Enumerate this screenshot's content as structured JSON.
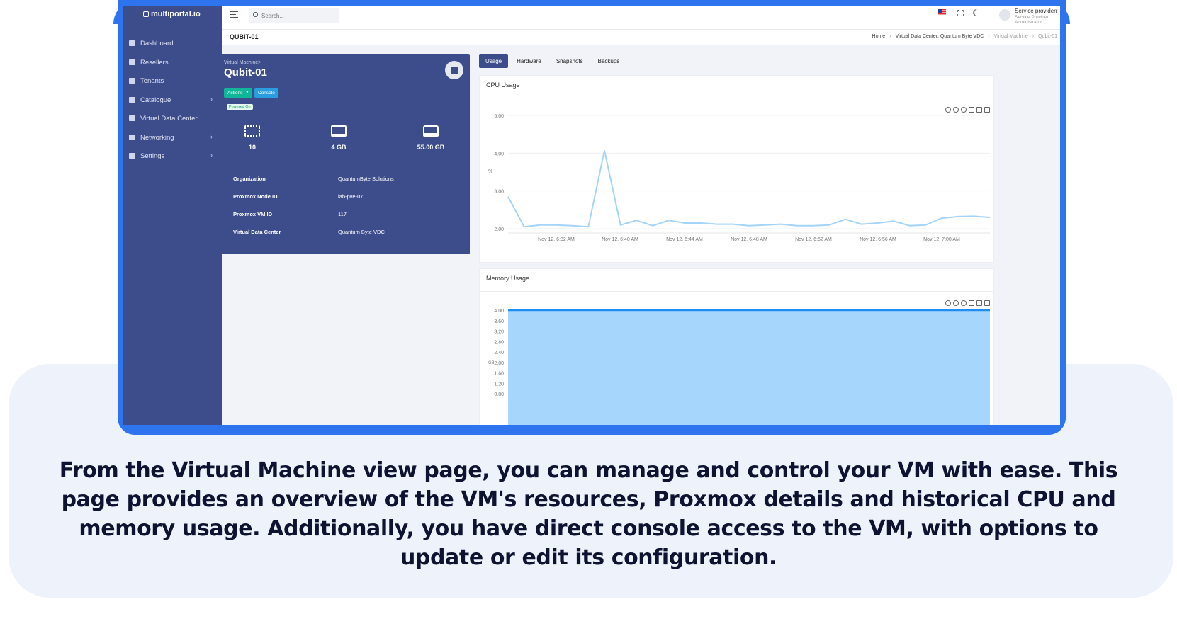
{
  "app": {
    "brand": "multiportal.io"
  },
  "sidebar": {
    "items": [
      {
        "label": "Dashboard",
        "icon": "dashboard-icon",
        "chevron": false
      },
      {
        "label": "Resellers",
        "icon": "resellers-icon",
        "chevron": false
      },
      {
        "label": "Tenants",
        "icon": "tenants-icon",
        "chevron": false
      },
      {
        "label": "Catalogue",
        "icon": "catalogue-icon",
        "chevron": true
      },
      {
        "label": "Virtual Data Center",
        "icon": "vdc-icon",
        "chevron": false
      },
      {
        "label": "Networking",
        "icon": "networking-icon",
        "chevron": true
      },
      {
        "label": "Settings",
        "icon": "settings-icon",
        "chevron": true
      }
    ]
  },
  "topbar": {
    "search_placeholder": "Search...",
    "user_name": "Service providerr",
    "user_role": "Service Provider Administrator"
  },
  "page": {
    "title": "QUBIT-01",
    "breadcrumb": [
      "Home",
      "Virtual Data Center: Quantum Byte VDC",
      "Virtual Machine",
      "Qubit-01"
    ]
  },
  "vm": {
    "subtitle": "Virtual Machine>",
    "name": "Qubit-01",
    "actions_label": "Actions",
    "console_label": "Console",
    "status": "Powered On",
    "resources": [
      {
        "icon": "cpu-icon",
        "value": "10"
      },
      {
        "icon": "memory-icon",
        "value": "4 GB"
      },
      {
        "icon": "disk-icon",
        "value": "55.00 GB"
      }
    ],
    "details": [
      {
        "label": "Organization",
        "value": "QuantumByte Solutions"
      },
      {
        "label": "Proxmox Node ID",
        "value": "lab-pve-07"
      },
      {
        "label": "Proxmox VM ID",
        "value": "117"
      },
      {
        "label": "Virtual Data Center",
        "value": "Quantum Byte VDC"
      }
    ]
  },
  "tabs": [
    {
      "label": "Usage",
      "active": true
    },
    {
      "label": "Hardware",
      "active": false
    },
    {
      "label": "Snapshots",
      "active": false
    },
    {
      "label": "Backups",
      "active": false
    }
  ],
  "cpu_panel": {
    "title": "CPU Usage"
  },
  "memory_panel": {
    "title": "Memory Usage"
  },
  "caption": "From the Virtual Machine view page, you can manage and control your VM with ease. This page provides an overview of the VM's resources, Proxmox details and historical CPU and memory usage. Additionally, you have direct console access to the VM, with options to update or edit its configuration.",
  "colors": {
    "sidebar": "#3d4d8c",
    "accent_green": "#10b69a",
    "accent_blue": "#2a9de0",
    "chart_line": "#a4d4f7",
    "memory_fill": "#a6d6fb",
    "memory_line": "#1f8ff5",
    "frame": "#2d74ee"
  },
  "chart_data": [
    {
      "type": "line",
      "title": "CPU Usage",
      "ylabel": "%",
      "ylim": [
        2.0,
        5.0
      ],
      "yticks": [
        "5.00",
        "4.00",
        "3.00",
        "2.00"
      ],
      "xticks": [
        "Nov 12, 6:32 AM",
        "Nov 12, 6:40 AM",
        "Nov 12, 6:44 AM",
        "Nov 12, 6:48 AM",
        "Nov 12, 6:52 AM",
        "Nov 12, 6:56 AM",
        "Nov 12, 7:00 AM"
      ],
      "series": [
        {
          "values": [
            2.85,
            2.05,
            2.1,
            2.1,
            2.08,
            2.05,
            4.07,
            2.1,
            2.22,
            2.08,
            2.22,
            2.15,
            2.15,
            2.12,
            2.12,
            2.08,
            2.1,
            2.12,
            2.08,
            2.08,
            2.1,
            2.25,
            2.12,
            2.15,
            2.2,
            2.08,
            2.1,
            2.28,
            2.32,
            2.33,
            2.3
          ]
        }
      ]
    },
    {
      "type": "area",
      "title": "Memory Usage",
      "ylabel": "GB",
      "ylim": [
        0.8,
        4.0
      ],
      "yticks": [
        "4.00",
        "3.60",
        "3.20",
        "2.80",
        "2.40",
        "2.00",
        "1.60",
        "1.20",
        "0.80"
      ],
      "series": [
        {
          "values": [
            4.0,
            4.0
          ]
        }
      ]
    }
  ]
}
